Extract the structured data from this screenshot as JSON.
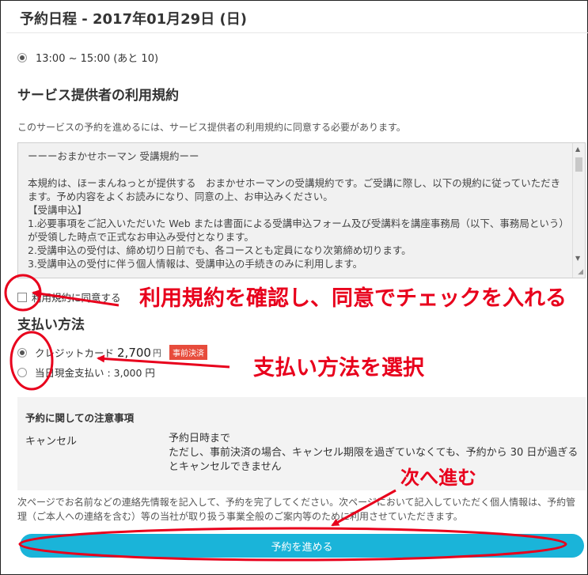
{
  "header": {
    "title": "予約日程 - 2017年01月29日 (日)"
  },
  "time_slot": {
    "label": "13:00 ~ 15:00 (あと 10)"
  },
  "terms": {
    "heading": "サービス提供者の利用規約",
    "description": "このサービスの予約を進めるには、サービス提供者の利用規約に同意する必要があります。",
    "text": "ーーーおまかせホーマン 受講規約ーー\n\n本規約は、ほーまんねっとが提供する　おまかせホーマンの受講規約です。ご受講に際し、以下の規約に従っていただきます。予め内容をよくお読みになり、同意の上、お申込みください。\n【受講申込】\n1.必要事項をご記入いただいた Web または書面による受講申込フォーム及び受講料を講座事務局（以下、事務局という）が受領した時点で正式なお申込み受付となります。\n2.受講申込の受付は、締め切り日前でも、各コースとも定員になり次第締め切ります。\n3.受講申込の受付に伴う個人情報は、受講申込の手続きのみに利用します。",
    "agree_label": "利用規約に同意する"
  },
  "payment": {
    "heading": "支払い方法",
    "options": [
      {
        "label": "クレジットカード",
        "price": "2,700",
        "unit": "円",
        "badge": "事前決済",
        "selected": true
      },
      {
        "label": "当日現金支払い : 3,000 円",
        "selected": false
      }
    ]
  },
  "notice": {
    "title": "予約に関しての注意事項",
    "label": "キャンセル",
    "text": "予約日時まで\nただし、事前決済の場合、キャンセル期限を過ぎていなくても、予約から 30 日が過ぎるとキャンセルできません"
  },
  "bottom_note": "次ページでお名前などの連絡先情報を記入して、予約を完了してください。次ページにおいて記入していただく個人情報は、予約管理（ご本人への連絡を含む）等の当社が取り扱う事業全般のご案内等のために利用させていただきます。",
  "submit": {
    "label": "予約を進める"
  },
  "annotations": {
    "check_text": "利用規約を確認し、同意でチェックを入れる",
    "payment_text": "支払い方法を選択",
    "next_text": "次へ進む"
  },
  "colors": {
    "accent": "#1ab4d9",
    "annotation_red": "#e8001c",
    "badge_red": "#e74c3c",
    "notice_bg": "#f3f3f3"
  }
}
